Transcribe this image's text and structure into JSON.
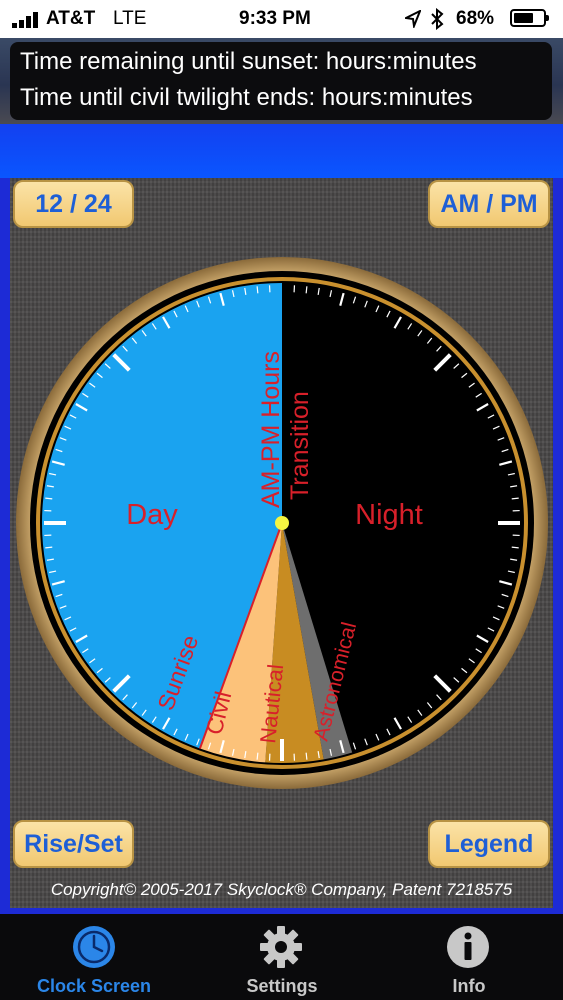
{
  "status_bar": {
    "carrier": "AT&T",
    "network": "LTE",
    "time": "9:33 PM",
    "battery_percent": "68%",
    "battery_level": 0.68
  },
  "header": {
    "line1": "Time remaining until sunset: hours:minutes",
    "line2": "Time until civil twilight ends: hours:minutes"
  },
  "buttons": {
    "format_12_24": "12 / 24",
    "am_pm": "AM / PM",
    "rise_set": "Rise/Set",
    "legend": "Legend"
  },
  "clock": {
    "labels": {
      "day": "Day",
      "night": "Night",
      "am_pm_hours": "AM-PM Hours",
      "transition": "Transition",
      "sunrise": "Sunrise",
      "civil": "Civil",
      "nautical": "Nautical",
      "astronomical": "Astronomical"
    },
    "colors": {
      "day": "#1aa3f0",
      "night": "#000000",
      "civil": "#fcc27a",
      "nautical": "#c88c22",
      "astronomical": "#6e6e6e",
      "label_red": "#d8202a",
      "center_dot": "#f5f542"
    }
  },
  "copyright": "Copyright© 2005-2017 Skyclock® Company, Patent 7218575",
  "tabs": [
    {
      "label": "Clock Screen",
      "icon": "clock-icon",
      "active": true
    },
    {
      "label": "Settings",
      "icon": "gear-icon",
      "active": false
    },
    {
      "label": "Info",
      "icon": "info-icon",
      "active": false
    }
  ],
  "theme": {
    "accent_blue": "#1e5fd6",
    "tab_active": "#2b86e8",
    "tab_inactive": "#c8c8c8"
  }
}
